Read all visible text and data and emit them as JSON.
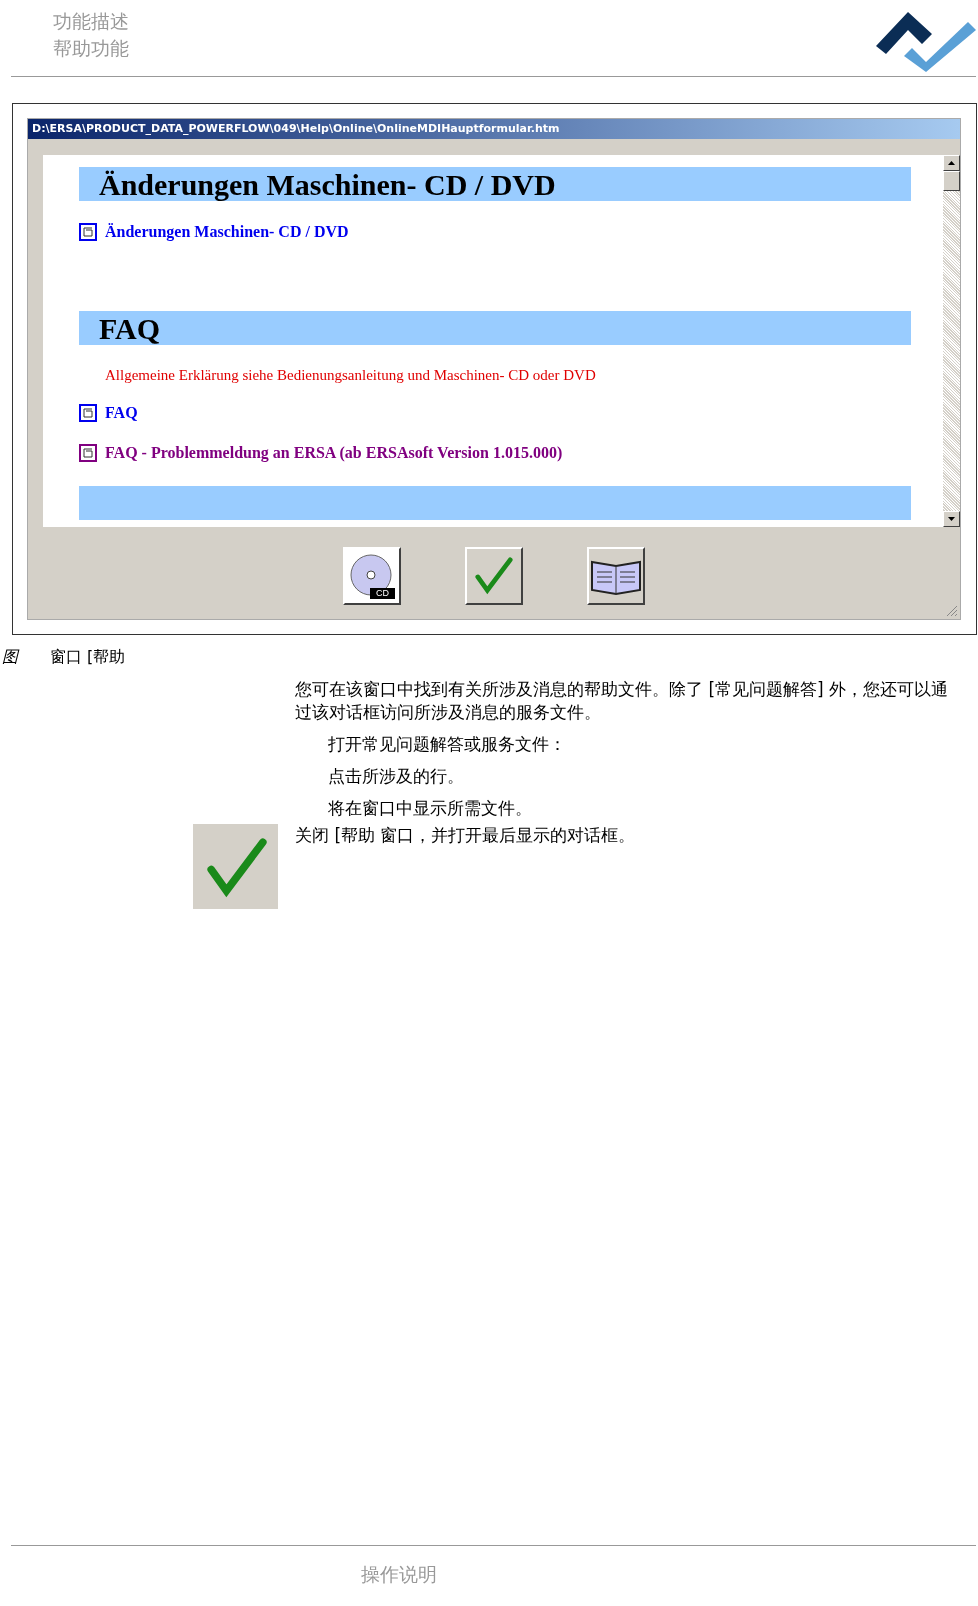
{
  "header": {
    "lines": [
      "功能描述",
      "帮助功能"
    ]
  },
  "screenshot": {
    "window": {
      "title": "D:\\ERSA\\PRODUCT_DATA_POWERFLOW\\049\\Help\\Online\\OnlineMDIHauptformular.htm"
    },
    "sections": [
      {
        "heading": "Änderungen Maschinen- CD / DVD",
        "items": [
          {
            "kind": "link",
            "text": "Änderungen Maschinen- CD / DVD",
            "visited": false
          }
        ]
      },
      {
        "heading": "FAQ",
        "items": [
          {
            "kind": "note",
            "text": "Allgemeine Erklärung siehe Bedienungsanleitung und Maschinen- CD oder DVD"
          },
          {
            "kind": "link",
            "text": "FAQ",
            "visited": false
          },
          {
            "kind": "link",
            "text": "FAQ - Problemmeldung an ERSA (ab ERSAsoft Version 1.015.000)",
            "visited": true
          }
        ]
      },
      {
        "kind": "cut"
      }
    ],
    "buttons": [
      {
        "kind": "cd",
        "label": "CD"
      },
      {
        "kind": "ok"
      },
      {
        "kind": "book"
      }
    ]
  },
  "caption": {
    "label": "图",
    "text": "窗口 [帮助"
  },
  "body": {
    "intro": "您可在该窗口中找到有关所涉及消息的帮助文件。除了 [常见问题解答] 外，您还可以通过该对话框访问所涉及消息的服务文件。",
    "steps": [
      "打开常见问题解答或服务文件：",
      "点击所涉及的行。",
      "将在窗口中显示所需文件。"
    ],
    "close_text": "关闭 [帮助  窗口，并打开最后显示的对话框。"
  },
  "footer": {
    "text": "操作说明"
  }
}
